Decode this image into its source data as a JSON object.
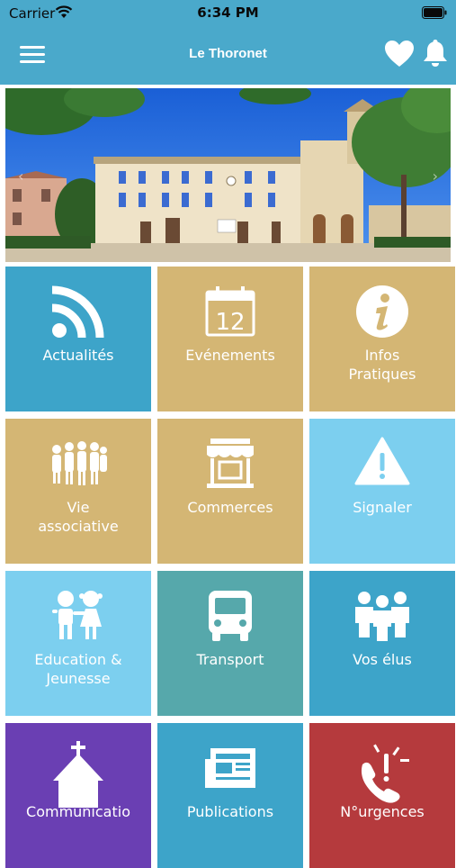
{
  "status_bar": {
    "carrier": "Carrier",
    "time": "6:34 PM"
  },
  "nav": {
    "title": "Le Thoronet",
    "menu_icon": "hamburger-icon",
    "favorite_icon": "heart-icon",
    "notification_icon": "bell-icon"
  },
  "banner": {
    "image": "town-hall-photo",
    "prev_icon": "chevron-left-icon",
    "next_icon": "chevron-right-icon"
  },
  "colors": {
    "header": "#4aa9cb",
    "blue": "#3da4c9",
    "gold": "#d4b674",
    "light_blue": "#7ccfef",
    "teal": "#56a8ab",
    "purple": "#6a3fb3",
    "red": "#b53a3d"
  },
  "tiles": [
    {
      "label": "Actualités",
      "icon": "rss-icon",
      "color": "#3da4c9"
    },
    {
      "label": "Evénements",
      "icon": "calendar-icon",
      "color": "#d4b674",
      "calendar_day": "12"
    },
    {
      "label": "Infos\nPratiques",
      "icon": "info-icon",
      "color": "#d4b674"
    },
    {
      "label": "Vie\nassociative",
      "icon": "people-icon",
      "color": "#d4b674"
    },
    {
      "label": "Commerces",
      "icon": "shop-icon",
      "color": "#d4b674"
    },
    {
      "label": "Signaler",
      "icon": "warning-icon",
      "color": "#7ccfef"
    },
    {
      "label": "Education &\nJeunesse",
      "icon": "children-icon",
      "color": "#7ccfef"
    },
    {
      "label": "Transport",
      "icon": "bus-icon",
      "color": "#56a8ab"
    },
    {
      "label": "Vos élus",
      "icon": "group-icon",
      "color": "#3da4c9"
    },
    {
      "label": "Communicatio",
      "icon": "church-icon",
      "color": "#6a3fb3"
    },
    {
      "label": "Publications",
      "icon": "newspaper-icon",
      "color": "#3da4c9"
    },
    {
      "label": "N°urgences",
      "icon": "phone-alert-icon",
      "color": "#b53a3d"
    }
  ]
}
